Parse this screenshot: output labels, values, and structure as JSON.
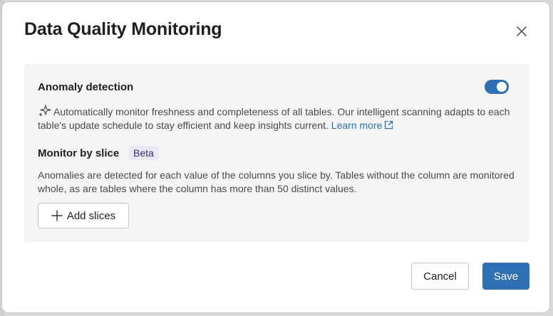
{
  "dialog": {
    "title": "Data Quality Monitoring",
    "close_icon": "close-icon"
  },
  "anomaly_detection": {
    "heading": "Anomaly detection",
    "toggle_on": true,
    "toggle_color": "#2f6fb3",
    "description": "Automatically monitor freshness and completeness of all tables. Our intelligent scanning adapts to each table's update schedule to stay efficient and keep insights current.",
    "sparkle_icon": "sparkle-icon",
    "learn_more_label": "Learn more",
    "external_link_icon": "external-link-icon"
  },
  "monitor_by_slice": {
    "heading": "Monitor by slice",
    "badge": "Beta",
    "description": "Anomalies are detected for each value of the columns you slice by. Tables without the column are monitored whole, as are tables where the column has more than 50 distinct values.",
    "add_slices_label": "Add slices",
    "plus_icon": "plus-icon"
  },
  "footer": {
    "cancel_label": "Cancel",
    "save_label": "Save",
    "primary_color": "#2f6fb3"
  }
}
